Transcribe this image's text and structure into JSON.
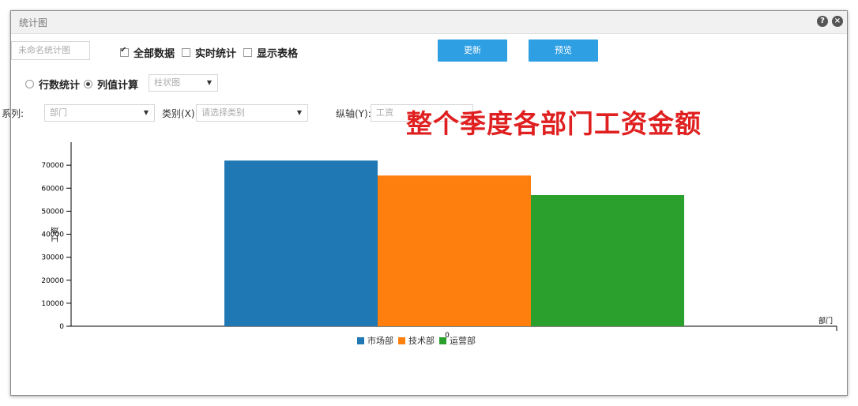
{
  "window": {
    "title": "统计图",
    "help_icon": "?",
    "close_icon": "×"
  },
  "toolbar": {
    "name_placeholder": "未命名统计图",
    "all_data_label": "全部数据",
    "all_data_checked": true,
    "realtime_label": "实时统计",
    "realtime_checked": false,
    "show_table_label": "显示表格",
    "show_table_checked": false,
    "update_label": "更新",
    "preview_label": "预览"
  },
  "mode": {
    "row_stat_label": "行数统计",
    "col_calc_label": "列值计算",
    "selected": "列值计算",
    "chart_type_value": "柱状图"
  },
  "axes_config": {
    "series_label": "系列:",
    "series_value": "部门",
    "category_label": "类别(X):",
    "category_placeholder": "请选择类别",
    "yaxis_label": "纵轴(Y):",
    "yaxis_value": "工资"
  },
  "overlay_title": "整个季度各部门工资金额",
  "colors": {
    "button": "#2e9fe3",
    "series": [
      "#1f77b4",
      "#ff7f0e",
      "#2ca02c"
    ],
    "overlay": "#e02020"
  },
  "chart_data": {
    "type": "bar",
    "categories": [
      "0"
    ],
    "series": [
      {
        "name": "市场部",
        "values": [
          72000
        ]
      },
      {
        "name": "技术部",
        "values": [
          65500
        ]
      },
      {
        "name": "运营部",
        "values": [
          57000
        ]
      }
    ],
    "ylabel": "工资",
    "xlabel": "部门",
    "ylim": [
      0,
      80000
    ],
    "yticks": [
      0,
      10000,
      20000,
      30000,
      40000,
      50000,
      60000,
      70000
    ],
    "legend": "bottom"
  }
}
